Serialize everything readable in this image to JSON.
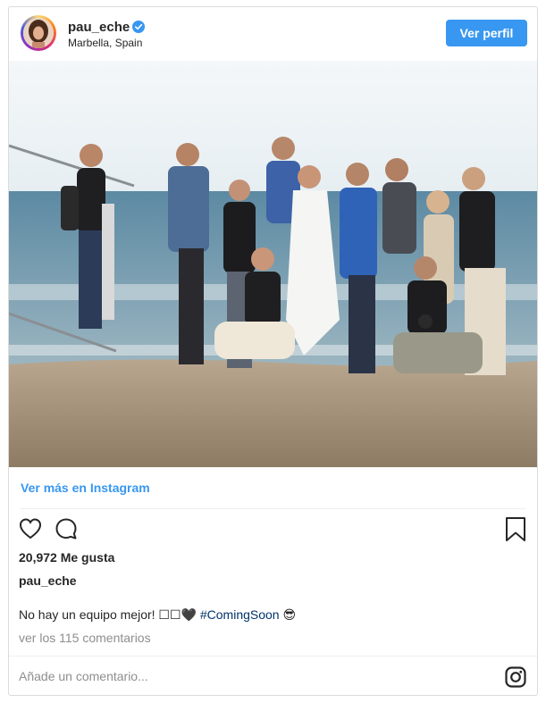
{
  "post": {
    "username": "pau_eche",
    "location": "Marbella, Spain",
    "profile_button": "Ver perfil",
    "see_more": "Ver más en Instagram",
    "likes": "20,972 Me gusta",
    "owner_name": "pau_eche",
    "caption_text": "No hay un equipo mejor! ☐☐🖤 ",
    "caption_hashtag": "#ComingSoon",
    "caption_emoji": " 😎",
    "view_comments": "ver los 115 comentarios",
    "comment_placeholder": "Añade un comentario..."
  },
  "icons": {
    "verified": "verified-badge-icon",
    "heart": "heart-icon",
    "comment": "comment-icon",
    "bookmark": "bookmark-icon",
    "instagram": "instagram-glyph-icon"
  },
  "colors": {
    "accent": "#3897f0",
    "hashtag": "#003569",
    "muted": "#8e8e8e",
    "border": "#dbdbdb"
  }
}
